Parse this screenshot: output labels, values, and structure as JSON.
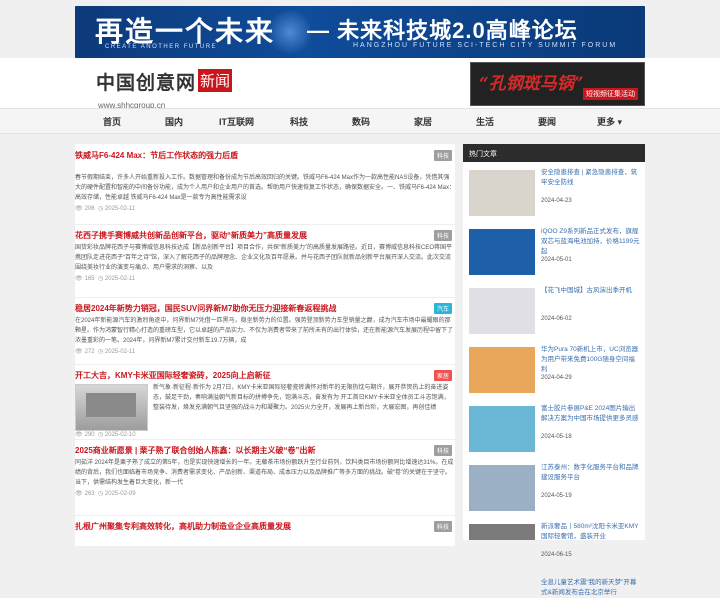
{
  "banner": {
    "left_title": "再造一个未来",
    "left_sub": "CREATE ANOTHER FUTURE",
    "right_title": "— 未来科技城2.0高峰论坛",
    "right_sub": "HANGZHOU FUTURE SCI-TECH CITY SUMMIT FORUM"
  },
  "header": {
    "logo_main": "中国创意网",
    "logo_tag": "新闻",
    "logo_url": "www.shhcgroup.cn",
    "ad_title": "“孔钢斑马锅”",
    "ad_sub": "短视频征集活动"
  },
  "nav": {
    "items": [
      "首页",
      "国内",
      "IT互联网",
      "科技",
      "数码",
      "家居",
      "生活",
      "要闻",
      "更多 ▾"
    ]
  },
  "articles": [
    {
      "title": "铁威马F6-424 Max：节后工作状态的强力后盾",
      "tag": "科技",
      "tag_color": "#9e9e9e",
      "body": "春节假期结束，许多人开始重新投入工作。数据管理和备份成为节后高效回归的关键。铁威马F6-424 Max作为一款高性能NAS设备，凭借其强大的硬件配置和智能的中间备份功能，成为个人用户和企业用户的首选。帮助用户快速恢复工作状态，确保数据安全。一、铁威马F6-424 Max：高效存储，性能卓越 铁威马F6-424 Max是一款专为高性能需求设",
      "views": "206",
      "date": "2025-02-11"
    },
    {
      "title": "花西子携手赛博威共创新品创新平台，驱动“新质美力”高质量发展",
      "tag": "科技",
      "tag_color": "#9e9e9e",
      "body": "国货彩妆品牌花西子与赛博威信息科技达成【新品创新平台】项目合作，共探“新质美力”的高质量发展路径。近日，赛博威信息科技CEO蒋国平携团队走进花西子“百年之诗”馆，深入了解花西子的品牌理念、企业文化及百年愿景。并与花西子团队就新品创新平台展开深入交流。此次交流围绕美妆行业的演变与痛点、用户需求的洞察、以及",
      "views": "165",
      "date": "2025-02-11"
    },
    {
      "title": "稳居2024年新势力销冠，国民SUV问界新M7助你无压力迎接新春返程挑战",
      "tag": "汽车",
      "tag_color": "#29b6d8",
      "body": "在2024年新能源汽车的激烈角逐中，问界新M7凭借一匹黑马，稳坐新势力的位置。强势登顶新势力车型销量之巅，成为汽车市场中最耀眼的那颗星。作为鸿蒙智行精心打造的重磅车型，它以卓越的产品实力、不仅为消费者带来了前所未有的出行体验，还在新能源汽车发展历程中留下了浓墨重彩的一笔。2024年，问界新M7累计交付新车19.7万辆，成",
      "views": "272",
      "date": "2025-02-11"
    },
    {
      "title": "开工大吉，KMY卡米亚国际轻奢瓷砖，2025向上启新征",
      "tag": "家居",
      "tag_color": "#ef5350",
      "body": "新气象·新征程·新作为 2月7日，KMY卡米亚国际轻奢瓷砖满怀对新年的无限热忱与期许，展开恭贺热上的奋进姿态，鼓足干劲，奏响满溢朝气新目标的拼搏争先，饱满斗志，奋发有为 开工首日KMY卡米亚全体员工斗志饱满，整装待发，焕发充满朝气且坚强的战斗力和凝聚力。2025火力全开，发展再上新台阶，大展宏图，再创佳绩",
      "views": "290",
      "date": "2025-02-10"
    },
    {
      "title": "2025商业新愿景 | 栗子熟了联合创始人陈鑫：以长期主义破“卷”出新",
      "tag": "科技",
      "tag_color": "#9e9e9e",
      "body": "同茹洋 2024年是栗子熟了成立的第5年，也是实现快速增长的一年。无藤茶市场份额跃升至行业前列，饮料类目市场份额同比增速达31%。在成绩的背后，我们也面临着市场竞争、消费者需求变化、产品创新、渠道布局、成本压力以及品牌推广等多方面的挑战。破“卷”的关键在于坚守。当下，供需结构发生着巨大变化，新一代",
      "views": "263",
      "date": "2025-02-09"
    },
    {
      "title": "扎根广州聚集专利高效转化，高机助力制造业企业高质量发展",
      "tag": "科技",
      "tag_color": "#9e9e9e"
    }
  ],
  "sidebar": {
    "header": "热门文章",
    "items": [
      {
        "title": "安全隐患排查 | 紧急隐患排查，筑牢安全防线",
        "date": "2024-04-23",
        "thumb": "#d9d4cc"
      },
      {
        "title": "iQOO Z9系列新品正式发布，旗舰双芯与蓝海电池加持，价格1199元起",
        "date": "2024-05-01",
        "thumb": "#1d5fa8"
      },
      {
        "title": "【花飞中国城】古风演出季开机",
        "date": "2024-06-02",
        "thumb": "#e0dfe5"
      },
      {
        "title": "华为Pura 70新机上市，UC浏览器为用户带来免费100G随身空间福利",
        "date": "2024-04-29",
        "thumb": "#e8a75a"
      },
      {
        "title": "富士胶片参展P&E 2024图片输出解决方案为中国市场提供更多灵感",
        "date": "2024-05-18",
        "thumb": "#6bb7d6"
      },
      {
        "title": "江苏泰州：数字化服务平台和品牌建设服务平台",
        "date": "2024-05-19",
        "thumb": "#9bb0c4"
      },
      {
        "title": "新派奢品丨580m²沈阳卡米亚KMY国际轻奢馆，盛装开业",
        "date": "2024-06-15",
        "thumb": "#7a7a7a"
      },
      {
        "title": "全息儿童艺术震“我的新天梦”开幕式&新闻发布会在北京举行",
        "date": "",
        "thumb": "#b7aa98"
      }
    ]
  }
}
